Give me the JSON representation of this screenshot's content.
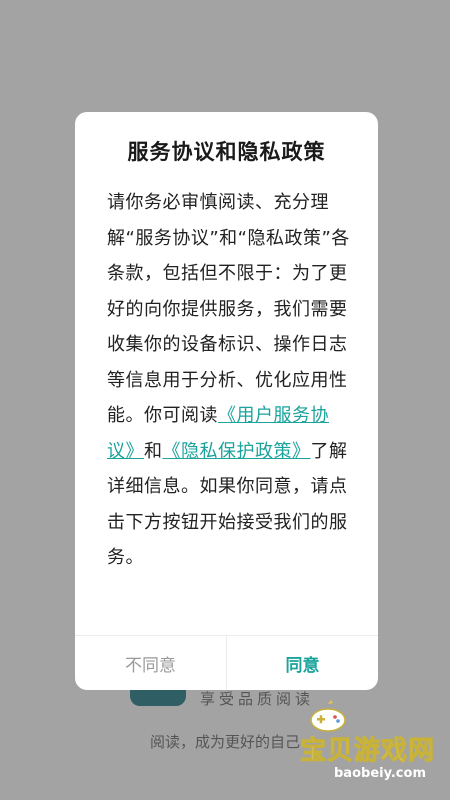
{
  "dialog": {
    "title": "服务协议和隐私政策",
    "body_before": "请你务必审慎阅读、充分理解“服务协议”和“隐私政策”各条款，包括但不限于：为了更好的向你提供服务，我们需要收集你的设备标识、操作日志等信息用于分析、优化应用性能。你可阅读",
    "link_user_agreement": "《用户服务协议》",
    "body_and": "和",
    "link_privacy_policy": "《隐私保护政策》",
    "body_after": "了解详细信息。如果你同意，请点击下方按钮开始接受我们的服务。",
    "disagree_label": "不同意",
    "agree_label": "同意"
  },
  "splash": {
    "slogan": "享受品质阅读",
    "tagline": "阅读，成为更好的自己"
  },
  "watermark": {
    "text": "宝贝游戏网",
    "url": "baobeiy.com"
  },
  "colors": {
    "accent": "#1ba39c",
    "overlay": "#a3a3a3"
  }
}
